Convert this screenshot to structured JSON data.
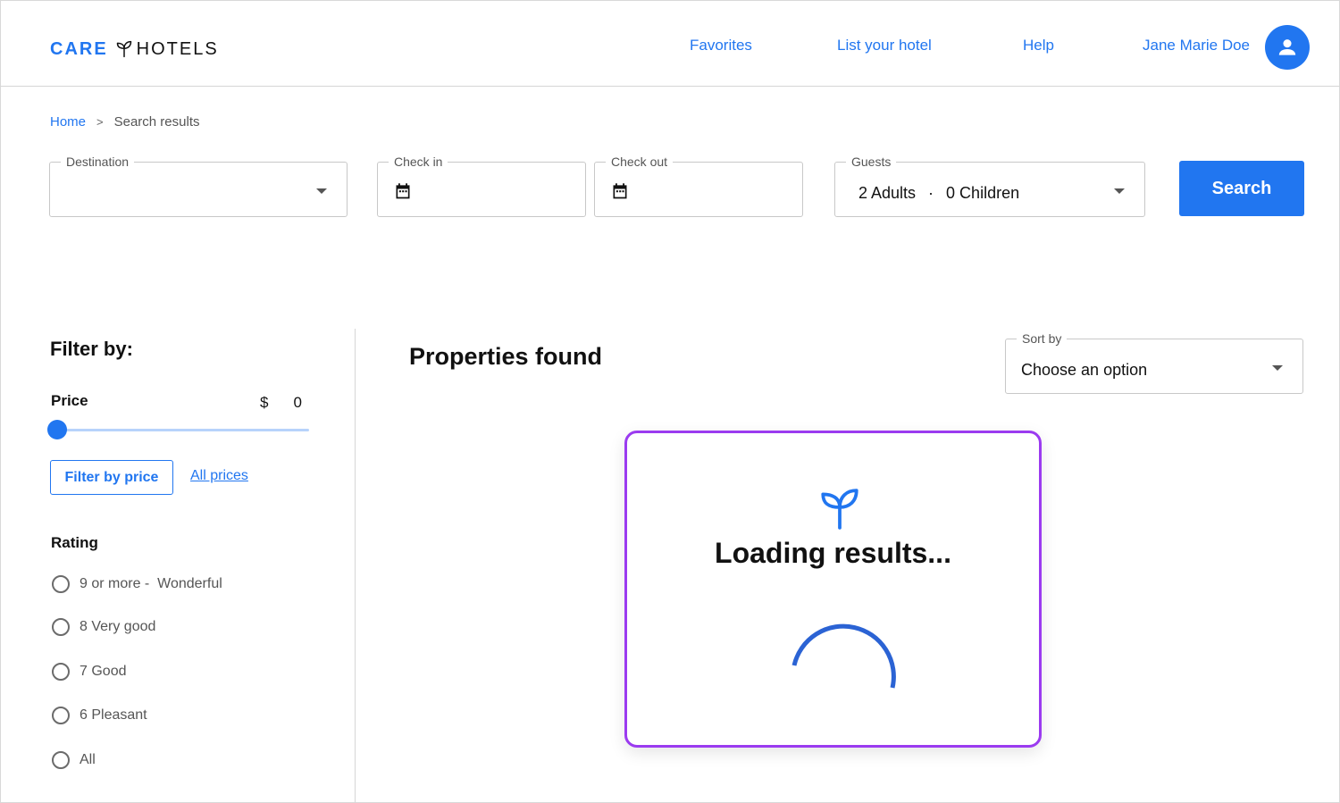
{
  "header": {
    "logo_primary": "CARE",
    "logo_secondary": "HOTELS",
    "nav": {
      "favorites": "Favorites",
      "list_hotel": "List your hotel",
      "help": "Help",
      "user_name": "Jane Marie Doe"
    },
    "accent": "#2176f0"
  },
  "breadcrumb": {
    "home": "Home",
    "separator": ">",
    "current": "Search results"
  },
  "search": {
    "destination": {
      "label": "Destination",
      "value": ""
    },
    "check_in": {
      "label": "Check in",
      "value": ""
    },
    "check_out": {
      "label": "Check out",
      "value": ""
    },
    "guests": {
      "label": "Guests",
      "adults": "2 Adults",
      "separator": "·",
      "children": "0 Children"
    },
    "button": "Search"
  },
  "filters": {
    "title": "Filter by:",
    "price": {
      "label": "Price",
      "currency": "$",
      "value": "0",
      "slider_fraction": 0,
      "filter_button": "Filter by price",
      "all_prices": "All prices"
    },
    "rating": {
      "title": "Rating",
      "options": [
        "9 or more -  Wonderful",
        "8 Very good",
        "7 Good",
        "6 Pleasant",
        "All"
      ]
    }
  },
  "results": {
    "title": "Properties found",
    "sort": {
      "label": "Sort by",
      "value": "Choose an option"
    },
    "loading": {
      "text": "Loading results...",
      "border_color": "#9b3bf0"
    }
  }
}
